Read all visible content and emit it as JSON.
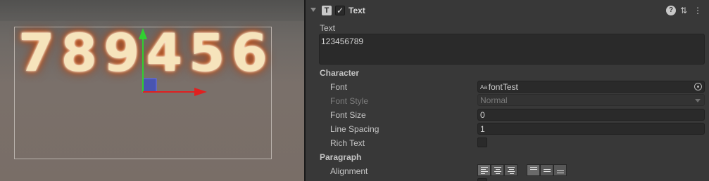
{
  "scene": {
    "digits": [
      "7",
      "8",
      "9",
      "4",
      "5",
      "6"
    ]
  },
  "component": {
    "title": "Text",
    "icon": "text-component-icon",
    "enabled": true,
    "text_label": "Text",
    "text_value": "123456789"
  },
  "character": {
    "section_label": "Character",
    "font_label": "Font",
    "font_value": "fontTest",
    "font_icon_text": "Aa",
    "font_style_label": "Font Style",
    "font_style_value": "Normal",
    "font_size_label": "Font Size",
    "font_size_value": "0",
    "line_spacing_label": "Line Spacing",
    "line_spacing_value": "1",
    "rich_text_label": "Rich Text",
    "rich_text_checked": false
  },
  "paragraph": {
    "section_label": "Paragraph",
    "alignment_label": "Alignment",
    "horizontal_selected": "left",
    "vertical_selected": "top"
  },
  "colors": {
    "gizmo_x": "#e02020",
    "gizmo_y": "#30d030",
    "gizmo_plane": "#3a4cc8",
    "glyph_fill": "#f6e4bc",
    "glyph_glow": "#d25a20"
  }
}
